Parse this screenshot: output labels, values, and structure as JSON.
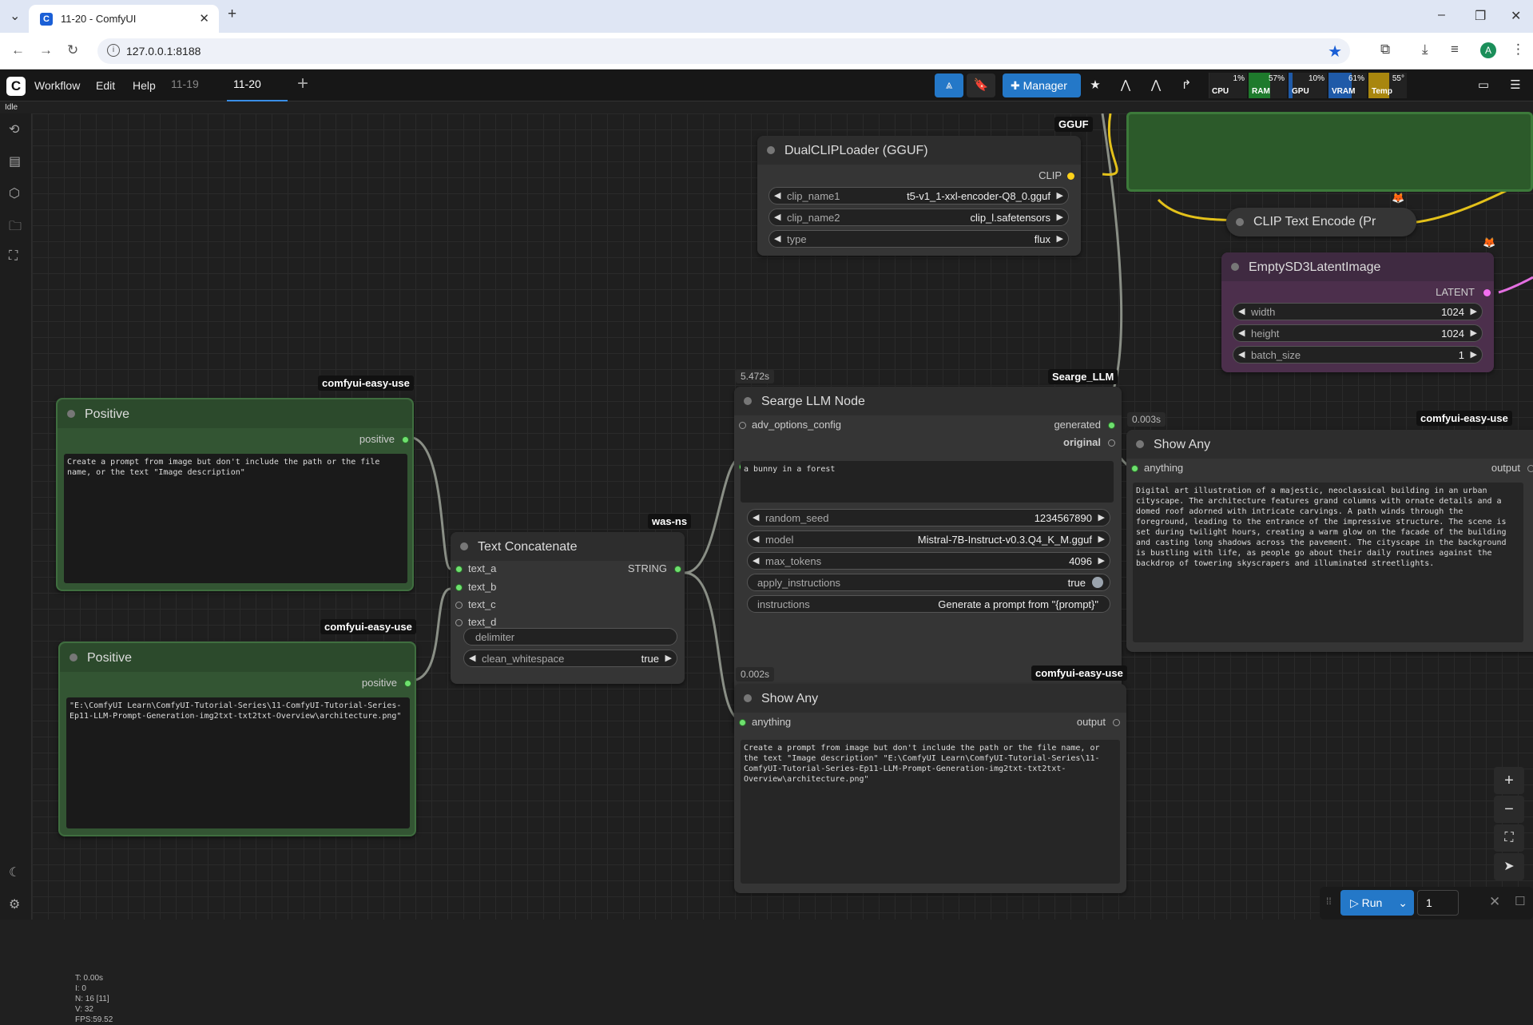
{
  "browser": {
    "tab_title": "11-20 - ComfyUI",
    "tab_close": "✕",
    "favicon_letter": "C",
    "url": "127.0.0.1:8188",
    "avatar_letter": "A"
  },
  "menu": {
    "items": [
      "Workflow",
      "Edit",
      "Help"
    ],
    "workflow_tabs": [
      "11-19",
      "11-20"
    ],
    "active_tab": "11-20",
    "manager_label": "Manager",
    "status": "Idle"
  },
  "meters": [
    {
      "label": "CPU",
      "value": "1%",
      "level": 0.01,
      "color": "#2c2c2c"
    },
    {
      "label": "RAM",
      "value": "57%",
      "level": 0.57,
      "color": "#1e7a2c"
    },
    {
      "label": "GPU",
      "value": "10%",
      "level": 0.1,
      "color": "#1f5aa8"
    },
    {
      "label": "VRAM",
      "value": "61%",
      "level": 0.61,
      "color": "#1f5aa8"
    },
    {
      "label": "Temp",
      "value": "55°",
      "level": 0.55,
      "color": "#a8860e"
    }
  ],
  "nodes": {
    "dualclip": {
      "title": "DualCLIPLoader (GGUF)",
      "badge": "GGUF",
      "output": "CLIP",
      "widgets": [
        {
          "label": "clip_name1",
          "value": "t5-v1_1-xxl-encoder-Q8_0.gguf"
        },
        {
          "label": "clip_name2",
          "value": "clip_l.safetensors"
        },
        {
          "label": "type",
          "value": "flux"
        }
      ]
    },
    "clip_text": {
      "title": "CLIP Text Encode (Pr"
    },
    "empty_latent": {
      "title": "EmptySD3LatentImage",
      "output": "LATENT",
      "widgets": [
        {
          "label": "width",
          "value": "1024"
        },
        {
          "label": "height",
          "value": "1024"
        },
        {
          "label": "batch_size",
          "value": "1"
        }
      ]
    },
    "positive1": {
      "title": "Positive",
      "badge": "comfyui-easy-use",
      "output": "positive",
      "text": "Create a prompt from image but don't include the path or the file name, or the text \"Image description\""
    },
    "positive2": {
      "title": "Positive",
      "badge": "comfyui-easy-use",
      "output": "positive",
      "text": "\"E:\\ComfyUI Learn\\ComfyUI-Tutorial-Series\\11-ComfyUI-Tutorial-Series-Ep11-LLM-Prompt-Generation-img2txt-txt2txt-Overview\\architecture.png\""
    },
    "concat": {
      "title": "Text Concatenate",
      "badge": "was-ns",
      "output": "STRING",
      "inputs": [
        "text_a",
        "text_b",
        "text_c",
        "text_d"
      ],
      "delimiter_label": "delimiter",
      "cw_label": "clean_whitespace",
      "cw_value": "true"
    },
    "searge": {
      "title": "Searge LLM Node",
      "badge": "Searge_LLM",
      "time": "5.472s",
      "input": "adv_options_config",
      "outputs": [
        "generated",
        "original"
      ],
      "text": "a bunny in a forest",
      "widgets": [
        {
          "label": "random_seed",
          "value": "1234567890"
        },
        {
          "label": "model",
          "value": "Mistral-7B-Instruct-v0.3.Q4_K_M.gguf"
        },
        {
          "label": "max_tokens",
          "value": "4096"
        }
      ],
      "apply_label": "apply_instructions",
      "apply_value": "true",
      "instr_label": "instructions",
      "instr_value": "Generate a prompt from \"{prompt}\""
    },
    "show1": {
      "title": "Show Any",
      "badge": "comfyui-easy-use",
      "time": "0.003s",
      "input": "anything",
      "output": "output",
      "text": "Digital art illustration of a majestic, neoclassical building in an urban cityscape. The architecture features grand columns with ornate details and a domed roof adorned with intricate carvings. A path winds through the foreground, leading to the entrance of the impressive structure. The scene is set during twilight hours, creating a warm glow on the facade of the building and casting long shadows across the pavement. The cityscape in the background is bustling with life, as people go about their daily routines against the backdrop of towering skyscrapers and illuminated streetlights."
    },
    "show2": {
      "title": "Show Any",
      "badge": "comfyui-easy-use",
      "time": "0.002s",
      "input": "anything",
      "output": "output",
      "text": "Create a prompt from image but don't include the path or the file name, or the text \"Image description\" \"E:\\ComfyUI Learn\\ComfyUI-Tutorial-Series\\11-ComfyUI-Tutorial-Series-Ep11-LLM-Prompt-Generation-img2txt-txt2txt-Overview\\architecture.png\""
    }
  },
  "stats": [
    "T: 0.00s",
    "I: 0",
    "N: 16 [11]",
    "V: 32",
    "FPS:59.52"
  ],
  "run": {
    "label": "Run",
    "count": "1"
  }
}
